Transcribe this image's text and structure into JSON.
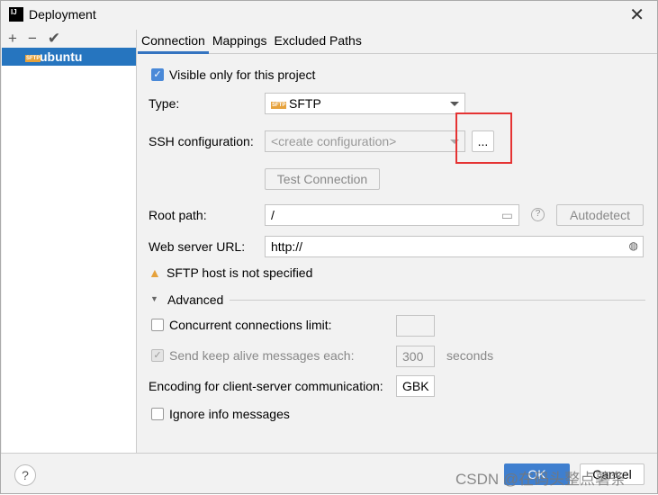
{
  "window": {
    "title": "Deployment",
    "logo": "IJ"
  },
  "sidebar": {
    "toolbar": [
      "+",
      "−",
      "✔"
    ],
    "items": [
      {
        "label": "ubuntu",
        "icon": "SFTP"
      }
    ]
  },
  "tabs": [
    "Connection",
    "Mappings",
    "Excluded Paths"
  ],
  "connection": {
    "visible_only": "Visible only for this project",
    "type_label": "Type:",
    "type_value": "SFTP",
    "type_icon": "SFTP",
    "ssh_label": "SSH configuration:",
    "ssh_placeholder": "<create configuration>",
    "ssh_more": "...",
    "test_connection": "Test Connection",
    "root_label": "Root path:",
    "root_value": "/",
    "autodetect": "Autodetect",
    "web_label": "Web server URL:",
    "web_value": "http://",
    "warning": "SFTP host is not specified",
    "advanced": "Advanced",
    "concurrent": "Concurrent connections limit:",
    "concurrent_value": "",
    "keepalive": "Send keep alive messages each:",
    "keepalive_value": "300",
    "seconds": "seconds",
    "encoding_label": "Encoding for client-server communication:",
    "encoding_value": "GBK",
    "ignore_info": "Ignore info messages"
  },
  "footer": {
    "help": "?",
    "ok": "OK",
    "cancel": "Cancel"
  },
  "watermark": "CSDN @在码头整点薯条",
  "colors": {
    "accent": "#2675bf",
    "highlight": "#e53333"
  }
}
